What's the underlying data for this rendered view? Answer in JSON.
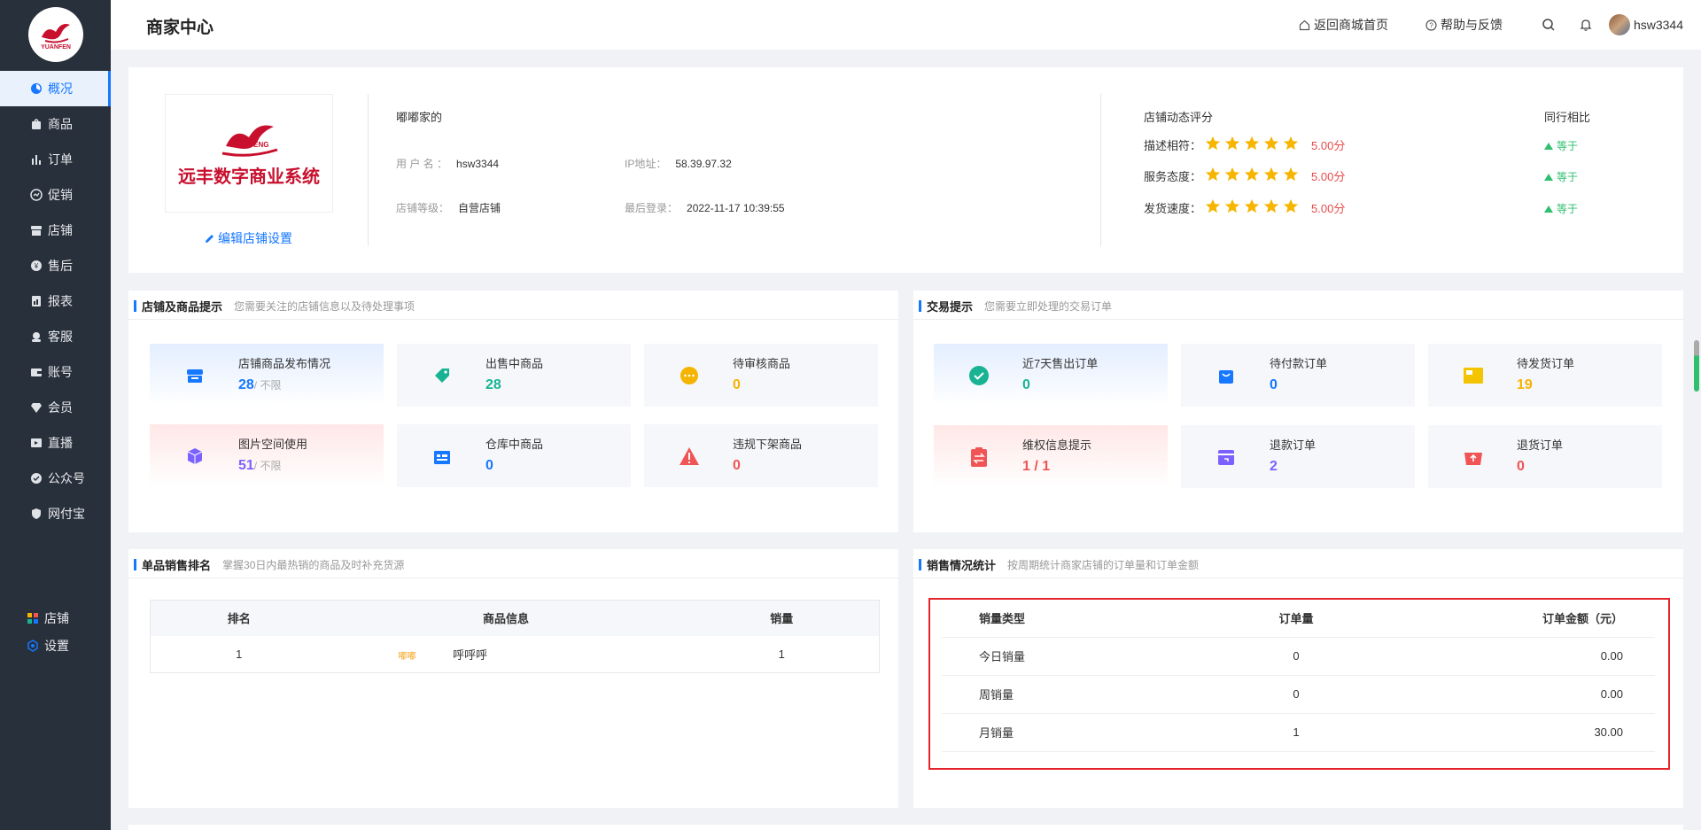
{
  "sidebar": {
    "logo_text": "YUANFEN",
    "items": [
      {
        "label": "概况",
        "icon": "dashboard-icon",
        "active": true
      },
      {
        "label": "商品",
        "icon": "goods-icon"
      },
      {
        "label": "订单",
        "icon": "bar-chart-icon"
      },
      {
        "label": "促销",
        "icon": "promotion-icon"
      },
      {
        "label": "店铺",
        "icon": "store-icon"
      },
      {
        "label": "售后",
        "icon": "after-sales-icon"
      },
      {
        "label": "报表",
        "icon": "report-icon"
      },
      {
        "label": "客服",
        "icon": "customer-service-icon"
      },
      {
        "label": "账号",
        "icon": "wallet-icon"
      },
      {
        "label": "会员",
        "icon": "diamond-icon"
      },
      {
        "label": "直播",
        "icon": "live-icon"
      },
      {
        "label": "公众号",
        "icon": "official-account-icon"
      },
      {
        "label": "网付宝",
        "icon": "shield-icon"
      }
    ],
    "bottom": [
      {
        "label": "店铺",
        "icon": "grid-apps-icon"
      },
      {
        "label": "设置",
        "icon": "settings-icon"
      }
    ]
  },
  "header": {
    "title": "商家中心",
    "back_home": "返回商城首页",
    "help": "帮助与反馈",
    "username": "hsw3344"
  },
  "shop": {
    "logo_brand": "YUANFENG",
    "logo_name": "远丰数字商业系统",
    "edit_label": "编辑店铺设置",
    "name": "嘟嘟家的",
    "username_label": "用 户 名 ：",
    "username": "hsw3344",
    "ip_label": "IP地址：",
    "ip": "58.39.97.32",
    "level_label": "店铺等级：",
    "level": "自营店铺",
    "last_login_label": "最后登录：",
    "last_login": "2022-11-17 10:39:55",
    "rating_title": "店铺动态评分",
    "peer_title": "同行相比",
    "ratings": [
      {
        "label": "描述相符：",
        "score": "5.00分",
        "stars": 5,
        "peer": "等于"
      },
      {
        "label": "服务态度：",
        "score": "5.00分",
        "stars": 5,
        "peer": "等于"
      },
      {
        "label": "发货速度：",
        "score": "5.00分",
        "stars": 5,
        "peer": "等于"
      }
    ]
  },
  "store_tips": {
    "title": "店铺及商品提示",
    "subtitle": "您需要关注的店铺信息以及待处理事项",
    "tiles": [
      {
        "label": "店铺商品发布情况",
        "value": "28",
        "suffix": "/ 不限",
        "color": "#1677ff",
        "icon": "store-box-icon"
      },
      {
        "label": "出售中商品",
        "value": "28",
        "color": "#19b394",
        "icon": "tag-icon"
      },
      {
        "label": "待审核商品",
        "value": "0",
        "color": "#f5b400",
        "icon": "more-dots-icon"
      },
      {
        "label": "图片空间使用",
        "value": "51",
        "suffix": "/ 不限",
        "color": "#7b61ff",
        "icon": "cube-icon"
      },
      {
        "label": "仓库中商品",
        "value": "0",
        "color": "#1677ff",
        "icon": "warehouse-icon"
      },
      {
        "label": "违规下架商品",
        "value": "0",
        "color": "#f05454",
        "icon": "warning-icon"
      }
    ]
  },
  "trade_tips": {
    "title": "交易提示",
    "subtitle": "您需要立即处理的交易订单",
    "tiles": [
      {
        "label": "近7天售出订单",
        "value": "0",
        "color": "#19b394",
        "icon": "check-circle-icon"
      },
      {
        "label": "待付款订单",
        "value": "0",
        "color": "#1677ff",
        "icon": "shopping-bag-icon"
      },
      {
        "label": "待发货订单",
        "value": "19",
        "color": "#f5b400",
        "icon": "package-icon"
      },
      {
        "label": "维权信息提示",
        "value": "1 / 1",
        "color": "#f05454",
        "icon": "clipboard-exchange-icon"
      },
      {
        "label": "退款订单",
        "value": "2",
        "color": "#7b61ff",
        "icon": "refund-icon"
      },
      {
        "label": "退货订单",
        "value": "0",
        "color": "#f05454",
        "icon": "return-cart-icon"
      }
    ]
  },
  "sales_rank": {
    "title": "单品销售排名",
    "subtitle": "掌握30日内最热销的商品及时补充货源",
    "columns": [
      "排名",
      "商品信息",
      "销量"
    ],
    "rows": [
      {
        "rank": "1",
        "thumb": "嘟嘟",
        "name": "呼呼呼",
        "sales": "1"
      }
    ]
  },
  "sales_stats": {
    "title": "销售情况统计",
    "subtitle": "按周期统计商家店铺的订单量和订单金额",
    "columns": [
      "销量类型",
      "订单量",
      "订单金额（元）"
    ],
    "rows": [
      {
        "type": "今日销量",
        "orders": "0",
        "amount": "0.00"
      },
      {
        "type": "周销量",
        "orders": "0",
        "amount": "0.00"
      },
      {
        "type": "月销量",
        "orders": "1",
        "amount": "30.00"
      }
    ]
  }
}
